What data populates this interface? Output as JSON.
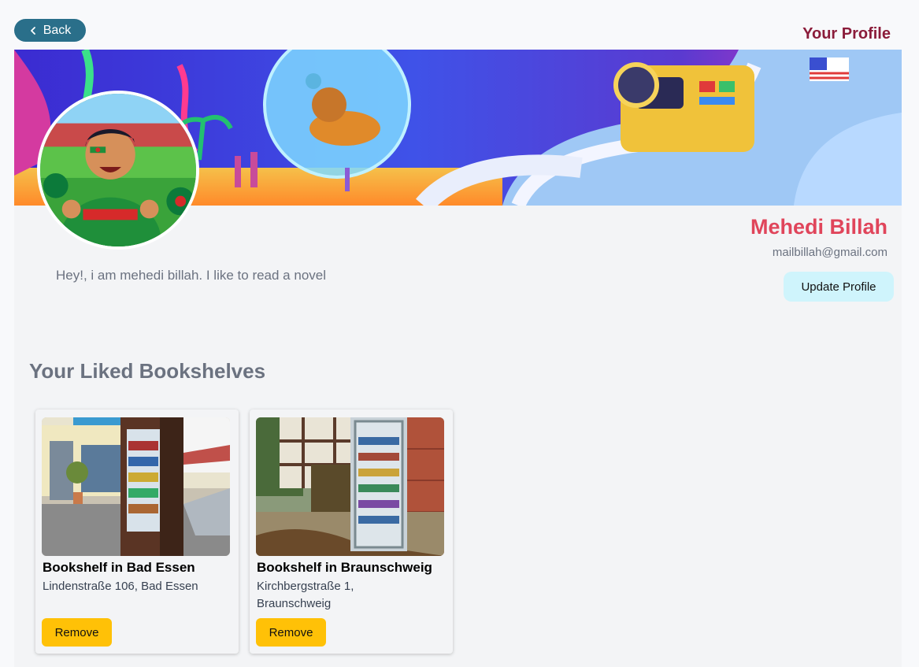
{
  "header": {
    "back_label": "Back",
    "page_title": "Your Profile"
  },
  "profile": {
    "name": "Mehedi Billah",
    "email": "mailbillah@gmail.com",
    "bio": "Hey!, i am mehedi billah. I like to read a novel",
    "update_label": "Update Profile"
  },
  "liked": {
    "section_title": "Your Liked Bookshelves",
    "cards": [
      {
        "title": "Bookshelf in Bad Essen",
        "address": "Lindenstraße 106, Bad Essen",
        "remove_label": "Remove"
      },
      {
        "title": "Bookshelf in Braunschweig",
        "address": "Kirchbergstraße 1, Braunschweig",
        "remove_label": "Remove"
      }
    ]
  },
  "colors": {
    "back_button": "#2a6f8a",
    "page_title": "#8b1c3a",
    "user_name": "#e0455b",
    "update_button": "#cff4fc",
    "remove_button": "#ffc107"
  },
  "icons": {
    "back": "chevron-left-icon"
  }
}
